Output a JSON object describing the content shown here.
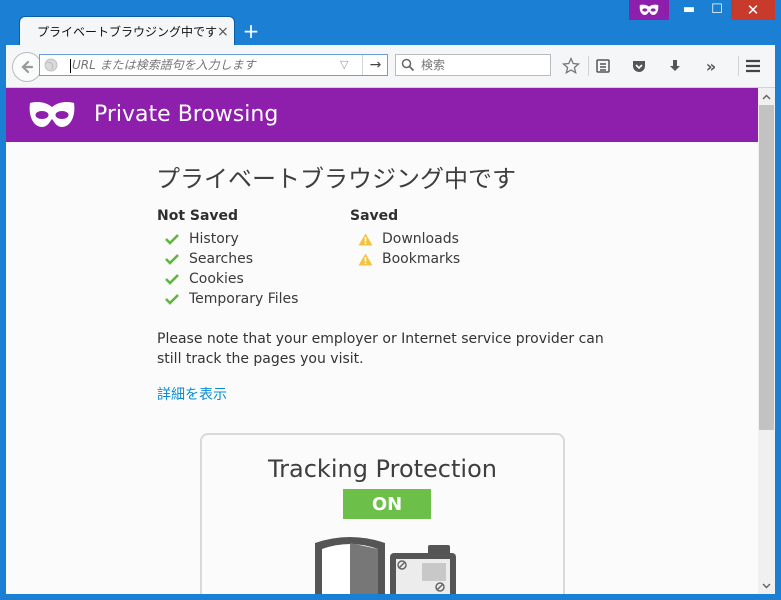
{
  "tab": {
    "title": "プライベートブラウジング中です",
    "close": "×",
    "newtab": "+"
  },
  "window": {
    "minimize": "▬",
    "maximize": "☐",
    "close": "✕"
  },
  "navbar": {
    "url_placeholder": "URL または検索語句を入力します",
    "url_dropdown": "▽",
    "go": "→",
    "search_placeholder": "検索",
    "overflow": "»"
  },
  "colors": {
    "accent": "#8d1fac",
    "titlebar": "#1b7fd4",
    "toggle_on": "#6cc04a",
    "link": "#0a8dcf",
    "check": "#5fb63d",
    "warning": "#f4c33d"
  },
  "header": {
    "title": "Private Browsing"
  },
  "main": {
    "title": "プライベートブラウジング中です",
    "not_saved": {
      "heading": "Not Saved",
      "items": [
        "History",
        "Searches",
        "Cookies",
        "Temporary Files"
      ]
    },
    "saved": {
      "heading": "Saved",
      "items": [
        "Downloads",
        "Bookmarks"
      ]
    },
    "note": "Please note that your employer or Internet service provider can still track the pages you visit.",
    "learn_more": "詳細を表示"
  },
  "tracking": {
    "title": "Tracking Protection",
    "toggle": "ON"
  }
}
